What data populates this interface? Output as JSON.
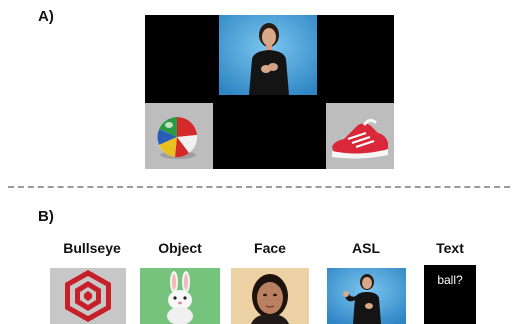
{
  "panel_a": {
    "label": "A)"
  },
  "panel_b": {
    "label": "B)",
    "stimuli": [
      {
        "label": "Bullseye"
      },
      {
        "label": "Object"
      },
      {
        "label": "Face"
      },
      {
        "label": "ASL"
      },
      {
        "label": "Text",
        "content": "ball?"
      }
    ]
  },
  "colors": {
    "video_background": "#47a6dd",
    "bullseye_red": "#c8202a",
    "object_green": "#76c37e",
    "divider": "#9a9a9a"
  }
}
